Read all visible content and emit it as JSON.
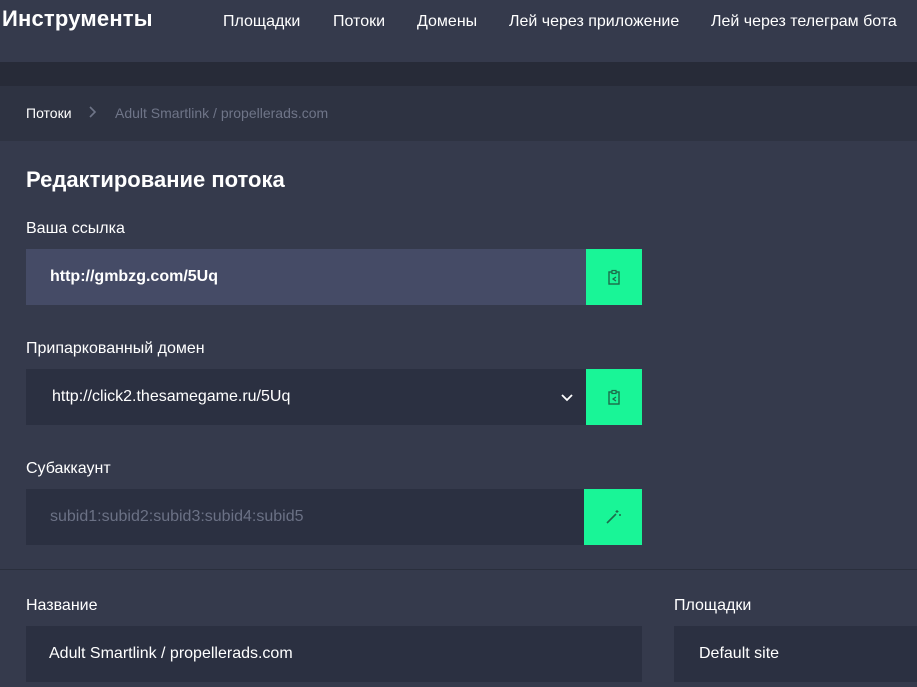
{
  "header": {
    "brand": "Инструменты",
    "nav": [
      {
        "label": "Площадки"
      },
      {
        "label": "Потоки"
      },
      {
        "label": "Домены"
      },
      {
        "label": "Лей через приложение"
      },
      {
        "label": "Лей через телеграм бота"
      }
    ]
  },
  "breadcrumb": {
    "root": "Потоки",
    "current": "Adult Smartlink / propellerads.com"
  },
  "form": {
    "title": "Редактирование потока",
    "link": {
      "label": "Ваша ссылка",
      "value": "http://gmbzg.com/5Uq",
      "button_icon": "copy-clipboard-icon"
    },
    "parked_domain": {
      "label": "Припаркованный домен",
      "value": "http://click2.thesamegame.ru/5Uq",
      "button_icon": "copy-clipboard-icon"
    },
    "subaccount": {
      "label": "Субаккаунт",
      "placeholder": "subid1:subid2:subid3:subid4:subid5",
      "button_icon": "magic-wand-icon"
    },
    "name": {
      "label": "Название",
      "value": "Adult Smartlink / propellerads.com"
    },
    "sites": {
      "label": "Площадки",
      "value": "Default site"
    }
  },
  "colors": {
    "accent": "#19f597",
    "header_bg": "#353a4c",
    "field_bg": "#2b3041",
    "field_highlight_bg": "#454b66",
    "muted_text": "#6f7588"
  }
}
